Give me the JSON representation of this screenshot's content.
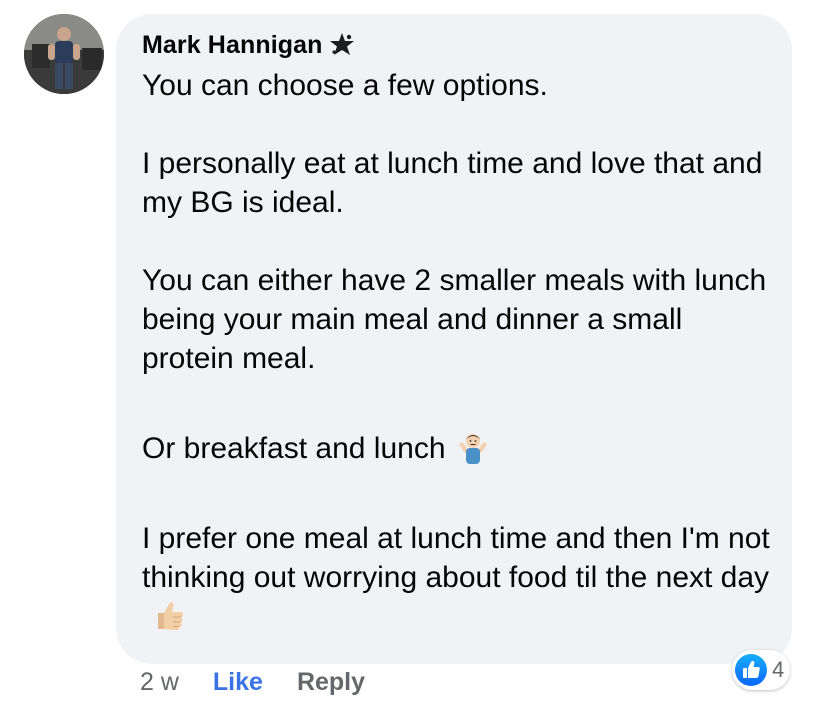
{
  "comment": {
    "author": "Mark Hannigan",
    "badge_icon": "top-fan-star-icon",
    "paragraphs": {
      "p1": "You can choose a few options.",
      "p2": "I personally eat at lunch time and love that and my BG is ideal.",
      "p3": "You can either have 2 smaller meals with lunch being your main meal and dinner a small protein meal.",
      "p4": "Or breakfast and lunch",
      "p5": "I prefer one meal at lunch time and then I'm not thinking out worrying about food til the next day"
    },
    "emojis": {
      "p4": "person-shrugging-emoji",
      "p5": "thumbs-up-emoji"
    }
  },
  "actions": {
    "time": "2 w",
    "like": "Like",
    "reply": "Reply"
  },
  "reactions": {
    "icon": "like-reaction-icon",
    "count": "4"
  },
  "colors": {
    "bubble": "#f0f2f5",
    "like_link": "#3b73e4",
    "meta_text": "#65676b",
    "reaction_blue": "#1877f2"
  }
}
